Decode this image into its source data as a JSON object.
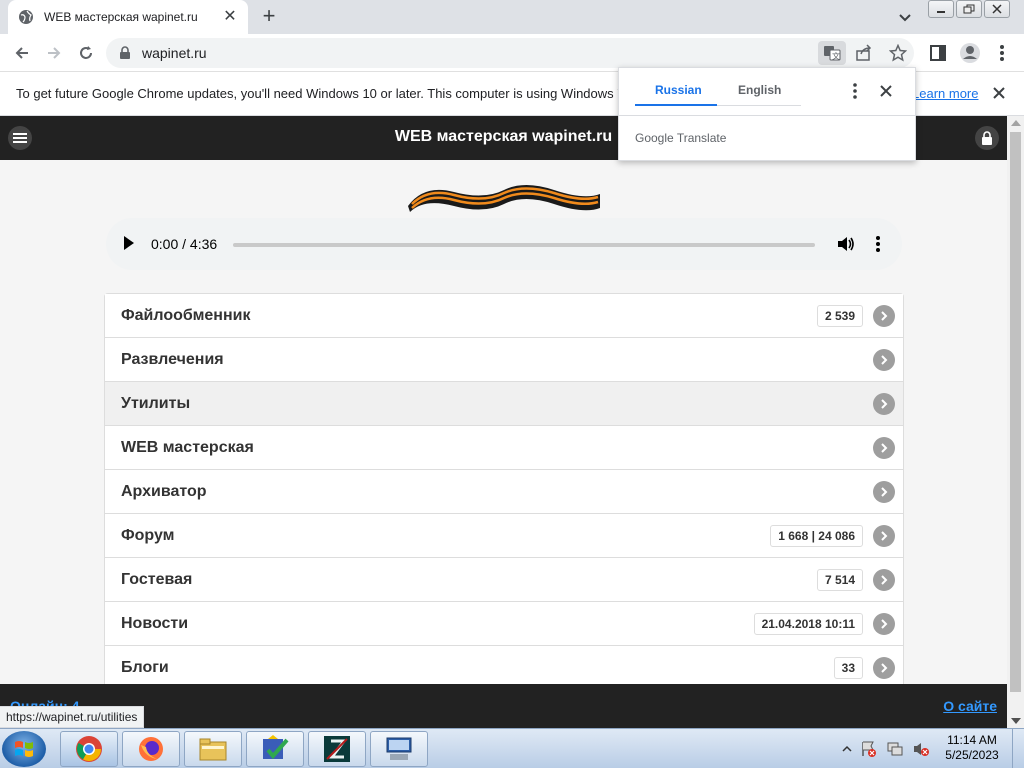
{
  "browser": {
    "tab_title": "WEB мастерская wapinet.ru",
    "url": "wapinet.ru",
    "infobar": {
      "message": "To get future Google Chrome updates, you'll need Windows 10 or later. This computer is using Windows 7.",
      "learn_more": "Learn more"
    },
    "status_url": "https://wapinet.ru/utilities"
  },
  "translate_popup": {
    "source_lang": "Russian",
    "target_lang": "English",
    "brand": "Google Translate"
  },
  "site": {
    "title": "WEB мастерская wapinet.ru",
    "player": {
      "time": "0:00 / 4:36"
    },
    "menu": [
      {
        "label": "Файлообменник",
        "badge": "2 539"
      },
      {
        "label": "Развлечения",
        "badge": ""
      },
      {
        "label": "Утилиты",
        "badge": ""
      },
      {
        "label": "WEB мастерская",
        "badge": ""
      },
      {
        "label": "Архиватор",
        "badge": ""
      },
      {
        "label": "Форум",
        "badge": "1 668 | 24 086"
      },
      {
        "label": "Гостевая",
        "badge": "7 514"
      },
      {
        "label": "Новости",
        "badge": "21.04.2018 10:11"
      },
      {
        "label": "Блоги",
        "badge": "33"
      }
    ],
    "footer": {
      "online": "Онлайн: 4",
      "about": "О сайте"
    }
  },
  "taskbar": {
    "apps": [
      "chrome-icon",
      "firefox-icon",
      "file-explorer-icon",
      "checklist-app-icon",
      "filezilla-icon",
      "network-app-icon"
    ],
    "clock_time": "11:14 AM",
    "clock_date": "5/25/2023"
  },
  "colors": {
    "header_bg": "#222222",
    "link_blue": "#3399ff",
    "chrome_blue": "#1a73e8"
  }
}
